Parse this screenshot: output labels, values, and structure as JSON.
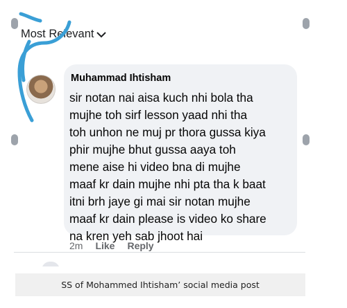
{
  "filter": {
    "label": "Most Relevant",
    "icon": "chevron-down-icon"
  },
  "comment": {
    "author": "Muhammad Ihtisham",
    "lines": [
      "sir notan nai aisa kuch nhi bola tha",
      "mujhe toh sirf lesson yaad nhi tha",
      "toh unhon ne muj pr thora gussa kiya",
      "phir mujhe bhut gussa aaya toh",
      "mene aise hi video bna di mujhe",
      "maaf kr dain mujhe nhi pta tha k baat",
      "itni brh jaye gi mai sir notan mujhe",
      "maaf kr dain please is video ko share",
      "na kren yeh sab jhoot hai"
    ],
    "time": "2m",
    "like_label": "Like",
    "reply_label": "Reply"
  },
  "caption": "SS of Mohammed Ihtisham’ social media post",
  "colors": {
    "bubble": "#f0f2f5",
    "scribble": "#3a9fd6",
    "meta": "#65676b"
  }
}
